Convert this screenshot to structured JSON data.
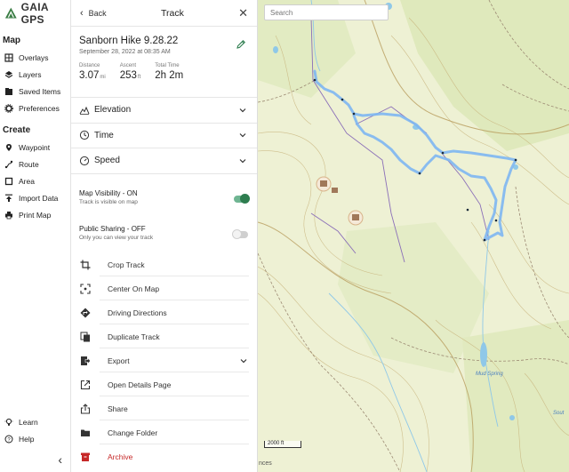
{
  "app": {
    "brand": "GAIA GPS"
  },
  "sidebar": {
    "map_title": "Map",
    "map_items": [
      {
        "label": "Overlays",
        "icon": "overlays-icon"
      },
      {
        "label": "Layers",
        "icon": "layers-icon"
      },
      {
        "label": "Saved Items",
        "icon": "saved-items-icon"
      },
      {
        "label": "Preferences",
        "icon": "gear-icon"
      }
    ],
    "create_title": "Create",
    "create_items": [
      {
        "label": "Waypoint",
        "icon": "pin-icon"
      },
      {
        "label": "Route",
        "icon": "route-icon"
      },
      {
        "label": "Area",
        "icon": "area-icon"
      },
      {
        "label": "Import Data",
        "icon": "upload-icon"
      },
      {
        "label": "Print Map",
        "icon": "printer-icon"
      }
    ],
    "bottom_items": [
      {
        "label": "Learn",
        "icon": "lightbulb-icon"
      },
      {
        "label": "Help",
        "icon": "help-icon"
      }
    ],
    "collapse": "‹"
  },
  "panel": {
    "back_label": "Back",
    "title": "Track",
    "track_name": "Sanborn Hike 9.28.22",
    "track_date": "September 28, 2022 at 08:35 AM",
    "stats": [
      {
        "label": "Distance",
        "value": "3.07",
        "unit": "mi"
      },
      {
        "label": "Ascent",
        "value": "253",
        "unit": "ft"
      },
      {
        "label": "Total Time",
        "value": "2h 2m",
        "unit": ""
      }
    ],
    "sections": [
      {
        "label": "Elevation",
        "icon": "elevation-icon"
      },
      {
        "label": "Time",
        "icon": "clock-icon"
      },
      {
        "label": "Speed",
        "icon": "speedometer-icon"
      }
    ],
    "visibility": {
      "title": "Map Visibility - ON",
      "subtitle": "Track is visible on map",
      "on": true
    },
    "sharing": {
      "title": "Public Sharing - OFF",
      "subtitle": "Only you can view your track",
      "on": false
    },
    "actions": [
      {
        "label": "Crop Track",
        "icon": "crop-icon"
      },
      {
        "label": "Center On Map",
        "icon": "center-focus-icon"
      },
      {
        "label": "Driving Directions",
        "icon": "directions-icon"
      },
      {
        "label": "Duplicate Track",
        "icon": "duplicate-icon"
      },
      {
        "label": "Export",
        "icon": "export-icon"
      },
      {
        "label": "Open Details Page",
        "icon": "open-external-icon"
      },
      {
        "label": "Share",
        "icon": "share-icon"
      },
      {
        "label": "Change Folder",
        "icon": "folder-icon"
      },
      {
        "label": "Archive",
        "icon": "archive-icon"
      }
    ]
  },
  "map": {
    "search_placeholder": "Search",
    "scale_label": "2000 ft",
    "attribution": "nces",
    "labels": {
      "spring": "Mud Spring",
      "edge": "Sout"
    },
    "colors": {
      "track": "#7db6f2",
      "water": "#8fc8e8",
      "contour": "#b9a46a",
      "forest": "#dbe6b6"
    }
  },
  "colors": {
    "accent_green": "#2e7d4f",
    "danger": "#c62828"
  }
}
